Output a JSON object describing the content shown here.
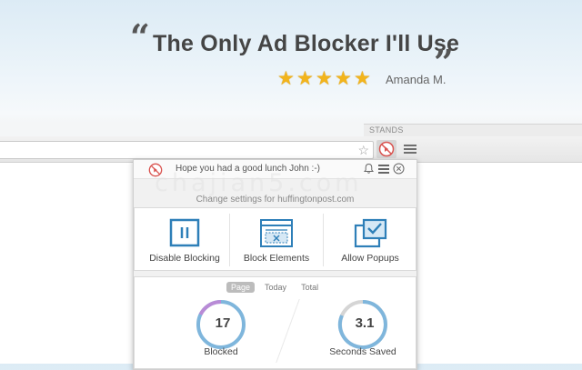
{
  "hero": {
    "quote_open": "“",
    "headline": "The Only Ad Blocker I'll Use",
    "quote_close": "”",
    "rating": 5,
    "reviewer": "Amanda M."
  },
  "browser": {
    "tab_label": "STANDS",
    "bookmark_icon": "star-outline-icon",
    "extension_icon": "adblock-logo-icon",
    "menu_icon": "hamburger-menu-icon"
  },
  "popup": {
    "greeting": "Hope you had a good lunch John :-)",
    "header_icons": [
      "bell-icon",
      "list-icon",
      "close-icon"
    ],
    "settings_link": "Change settings for huffingtonpost.com",
    "actions": [
      {
        "label": "Disable Blocking",
        "icon": "pause-icon"
      },
      {
        "label": "Block Elements",
        "icon": "block-element-icon"
      },
      {
        "label": "Allow Popups",
        "icon": "allow-popups-icon"
      }
    ],
    "stats_tabs": [
      "Page",
      "Today",
      "Total"
    ],
    "active_tab": "Page",
    "stats": [
      {
        "value": "17",
        "label": "Blocked"
      },
      {
        "value": "3.1",
        "label": "Seconds Saved"
      }
    ]
  },
  "watermark": "chajian5.com",
  "colors": {
    "accent_blue": "#2e7fb8",
    "logo_red": "#d9534f",
    "star_gold": "#f2b41c",
    "ring_purple": "#b98bd6",
    "ring_blue": "#7fb6dc"
  }
}
